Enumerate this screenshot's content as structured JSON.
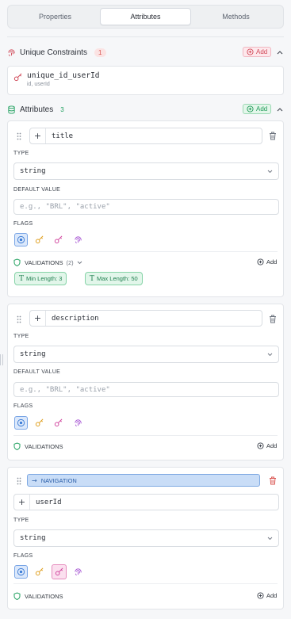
{
  "tabs": [
    {
      "label": "Properties"
    },
    {
      "label": "Attributes"
    },
    {
      "label": "Methods"
    }
  ],
  "unique": {
    "title": "Unique Constraints",
    "count": "1",
    "add_label": "Add",
    "items": [
      {
        "name": "unique_id_userId",
        "fields": "id, userId"
      }
    ]
  },
  "attributes": {
    "title": "Attributes",
    "count": "3",
    "add_label": "Add",
    "items": [
      {
        "name": "title",
        "type_label": "TYPE",
        "type": "string",
        "default_label": "DEFAULT VALUE",
        "default_placeholder": "e.g., \"BRL\", \"active\"",
        "flags_label": "FLAGS",
        "validations_label": "VALIDATIONS",
        "validations_count": "(2)",
        "add_label": "Add",
        "validations": [
          {
            "label": "Min Length: 3"
          },
          {
            "label": "Max Length: 50"
          }
        ]
      },
      {
        "name": "description",
        "type_label": "TYPE",
        "type": "string",
        "default_label": "DEFAULT VALUE",
        "default_placeholder": "e.g., \"BRL\", \"active\"",
        "flags_label": "FLAGS",
        "validations_label": "VALIDATIONS",
        "add_label": "Add"
      },
      {
        "nav_label": "NAVIGATION",
        "name": "userId",
        "type_label": "TYPE",
        "type": "string",
        "flags_label": "FLAGS",
        "validations_label": "VALIDATIONS",
        "add_label": "Add"
      }
    ]
  },
  "colors": {
    "accent_blue": "#3a7bd5",
    "accent_green": "#22a160",
    "accent_red": "#d9534f",
    "key_orange": "#e0a021",
    "key_pink": "#d24aa0",
    "fingerprint_purple": "#a34fd1"
  },
  "icons": [
    "fingerprint-icon",
    "key-icon",
    "database-icon",
    "chevron-up-icon",
    "plus-circle-icon",
    "drag-handle-icon",
    "trash-icon",
    "chevron-down-icon",
    "shield-icon",
    "text-type-icon",
    "arrow-right-icon"
  ]
}
